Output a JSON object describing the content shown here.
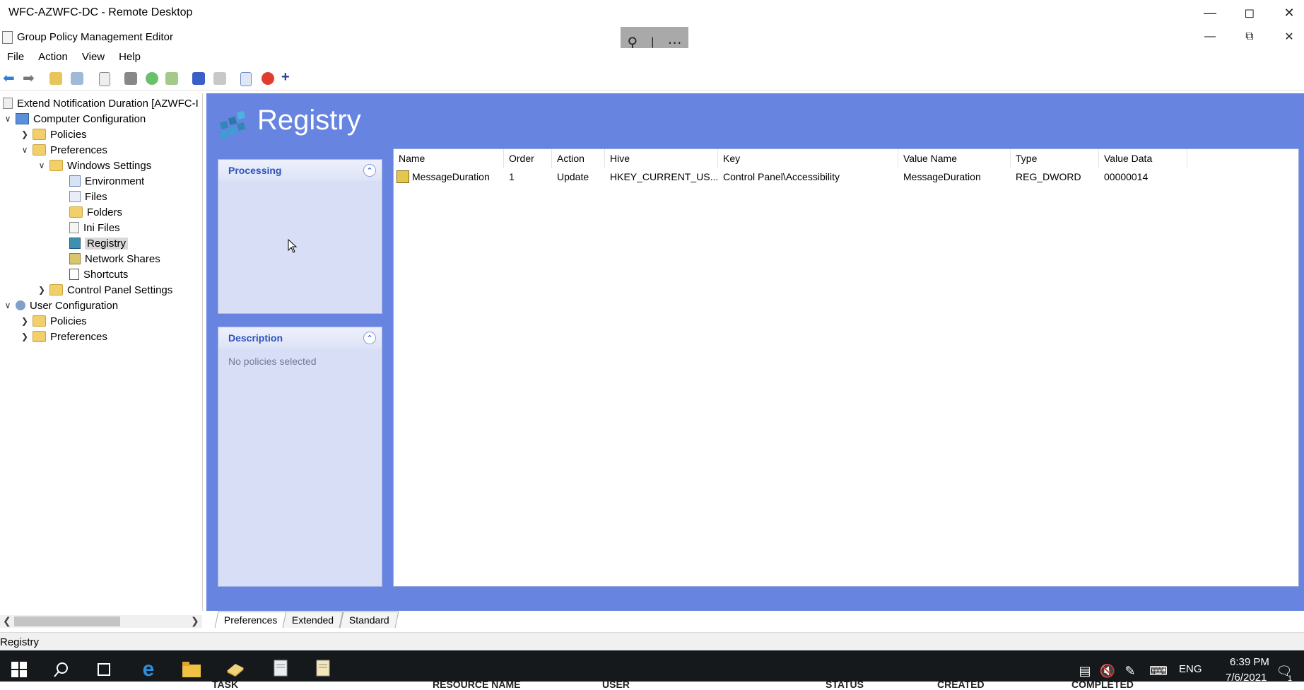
{
  "remote_window": {
    "title": "WFC-AZWFC-DC - Remote Desktop"
  },
  "app_window": {
    "title": "Group Policy Management Editor"
  },
  "menu": [
    "File",
    "Action",
    "View",
    "Help"
  ],
  "tree": [
    {
      "label": "Extend Notification Duration [AZWFC-I",
      "level": 0,
      "icon": "gpo-icon",
      "expander": ""
    },
    {
      "label": "Computer Configuration",
      "level": 0,
      "icon": "computer-icon",
      "expander": "expanded"
    },
    {
      "label": "Policies",
      "level": 1,
      "icon": "folder-icon",
      "expander": "collapsed"
    },
    {
      "label": "Preferences",
      "level": 1,
      "icon": "folder-icon",
      "expander": "expanded"
    },
    {
      "label": "Windows Settings",
      "level": 2,
      "icon": "folder-icon",
      "expander": "expanded"
    },
    {
      "label": "Environment",
      "level": 3,
      "icon": "environment-icon",
      "expander": ""
    },
    {
      "label": "Files",
      "level": 3,
      "icon": "files-icon",
      "expander": ""
    },
    {
      "label": "Folders",
      "level": 3,
      "icon": "folders-icon",
      "expander": ""
    },
    {
      "label": "Ini Files",
      "level": 3,
      "icon": "ini-files-icon",
      "expander": ""
    },
    {
      "label": "Registry",
      "level": 3,
      "icon": "registry-icon",
      "expander": "",
      "selected": true
    },
    {
      "label": "Network Shares",
      "level": 3,
      "icon": "network-shares-icon",
      "expander": ""
    },
    {
      "label": "Shortcuts",
      "level": 3,
      "icon": "shortcuts-icon",
      "expander": ""
    },
    {
      "label": "Control Panel Settings",
      "level": 2,
      "icon": "control-panel-icon",
      "expander": "collapsed"
    },
    {
      "label": "User Configuration",
      "level": 0,
      "icon": "user-icon",
      "expander": "expanded"
    },
    {
      "label": "Policies",
      "level": 1,
      "icon": "folder-icon",
      "expander": "collapsed"
    },
    {
      "label": "Preferences",
      "level": 1,
      "icon": "folder-icon",
      "expander": "collapsed"
    }
  ],
  "main": {
    "title": "Registry",
    "processing": {
      "title": "Processing"
    },
    "description": {
      "title": "Description",
      "text": "No policies selected"
    }
  },
  "table": {
    "columns": [
      "Name",
      "Order",
      "Action",
      "Hive",
      "Key",
      "Value Name",
      "Type",
      "Value Data"
    ],
    "rows": [
      [
        "MessageDuration",
        "1",
        "Update",
        "HKEY_CURRENT_US...",
        "Control Panel\\Accessibility",
        "MessageDuration",
        "REG_DWORD",
        "00000014"
      ]
    ]
  },
  "tabs": [
    {
      "label": "Preferences",
      "active": true
    },
    {
      "label": "Extended",
      "active": false
    },
    {
      "label": "Standard",
      "active": false
    }
  ],
  "status": {
    "text": "Registry"
  },
  "taskbar": {
    "language": "ENG",
    "time": "6:39 PM",
    "date": "7/6/2021",
    "notification_count": "1"
  },
  "background_columns": [
    "TASK",
    "RESOURCE NAME",
    "USER",
    "STATUS",
    "CREATED",
    "COMPLETED"
  ],
  "colors": {
    "main_bg": "#6684e0",
    "panel_bg": "#d8def5",
    "panel_title": "#2a52be",
    "taskbar": "#16191c"
  }
}
